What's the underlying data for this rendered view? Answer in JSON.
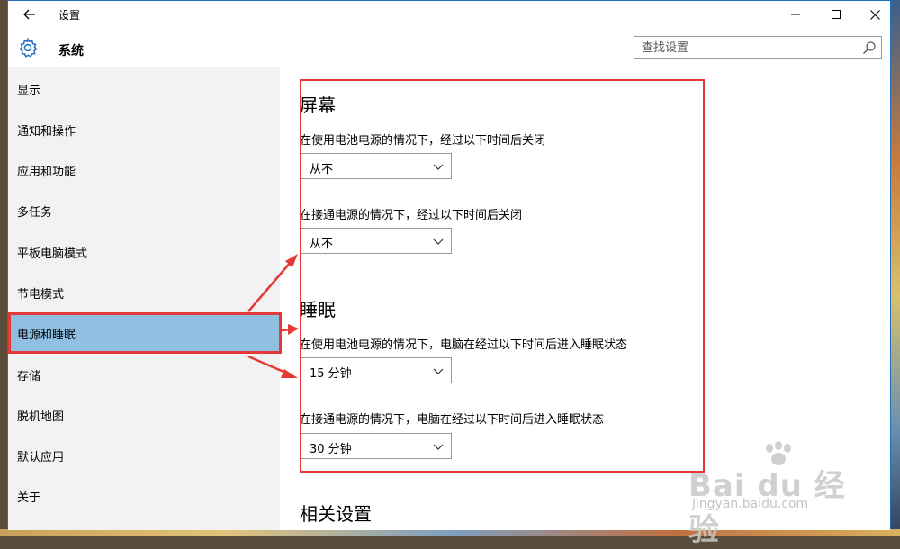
{
  "titlebar": {
    "title": "设置"
  },
  "header": {
    "title": "系统",
    "search_placeholder": "查找设置"
  },
  "sidebar": {
    "items": [
      {
        "label": "显示"
      },
      {
        "label": "通知和操作"
      },
      {
        "label": "应用和功能"
      },
      {
        "label": "多任务"
      },
      {
        "label": "平板电脑模式"
      },
      {
        "label": "节电模式"
      },
      {
        "label": "电源和睡眠",
        "active": true
      },
      {
        "label": "存储"
      },
      {
        "label": "脱机地图"
      },
      {
        "label": "默认应用"
      },
      {
        "label": "关于"
      }
    ]
  },
  "main": {
    "screen": {
      "title": "屏幕",
      "battery_label": "在使用电池电源的情况下，经过以下时间后关闭",
      "battery_value": "从不",
      "plugged_label": "在接通电源的情况下，经过以下时间后关闭",
      "plugged_value": "从不"
    },
    "sleep": {
      "title": "睡眠",
      "battery_label": "在使用电池电源的情况下，电脑在经过以下时间后进入睡眠状态",
      "battery_value": "15 分钟",
      "plugged_label": "在接通电源的情况下，电脑在经过以下时间后进入睡眠状态",
      "plugged_value": "30 分钟"
    },
    "related_title": "相关设置"
  },
  "watermark": {
    "brand": "Bai du 经验",
    "url": "jingyan.baidu.com"
  },
  "colors": {
    "accent_highlight": "#e53935",
    "active_nav": "#8fbfe3",
    "sidebar_bg": "#f2f2f2"
  }
}
